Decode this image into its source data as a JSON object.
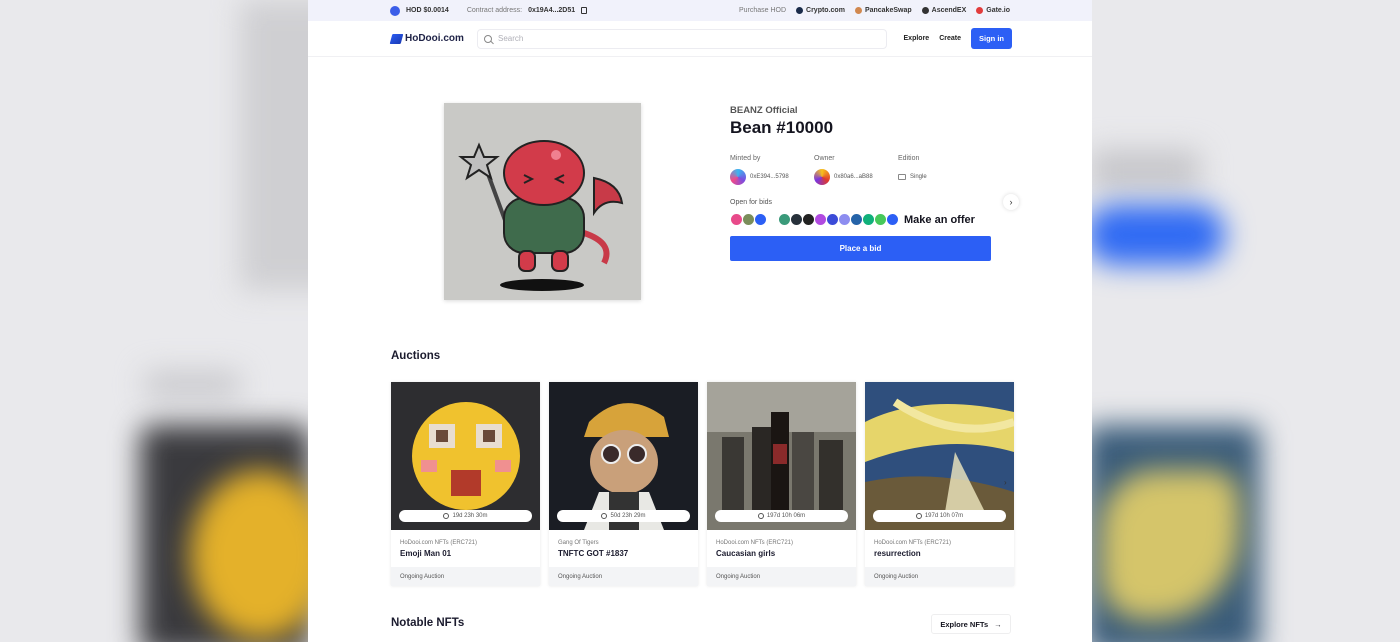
{
  "topbar": {
    "price": "HOD $0.0014",
    "contract_label": "Contract address:",
    "contract_value": "0x19A4...2D51",
    "purchase_label": "Purchase HOD",
    "exchanges": [
      {
        "name": "Crypto.com",
        "color": "#1a2b4a"
      },
      {
        "name": "PancakeSwap",
        "color": "#d1884f"
      },
      {
        "name": "AscendEX",
        "color": "#333333"
      },
      {
        "name": "Gate.io",
        "color": "#e23c3c"
      }
    ]
  },
  "nav": {
    "logo": "HoDooi.com",
    "search_placeholder": "Search",
    "explore": "Explore",
    "create": "Create",
    "signin": "Sign in"
  },
  "hero": {
    "collection": "BEANZ Official",
    "title": "Bean #10000",
    "minted_by_label": "Minted by",
    "owner_label": "Owner",
    "edition_label": "Edition",
    "minted_by_value": "0xE394...5798",
    "owner_value": "0x80a6...aB88",
    "edition_value": "Single",
    "open_for_bids": "Open for bids",
    "make_offer": "Make an offer",
    "place_bid": "Place a bid",
    "token_colors": [
      "#e84a8a",
      "#7a8d5a",
      "#2c5ff5",
      "#ffffff",
      "#3a9a7a",
      "#27303a",
      "#222222",
      "#b04ae0",
      "#3b4bd8",
      "#8d8df0",
      "#2563a8",
      "#10b07a",
      "#46c85a",
      "#2c5ff5"
    ]
  },
  "auctions": {
    "title": "Auctions",
    "cards": [
      {
        "timer": "19d 23h 30m",
        "collection": "HoDooi.com NFTs (ERC721)",
        "name": "Emoji Man 01",
        "status": "Ongoing Auction"
      },
      {
        "timer": "50d 23h 29m",
        "collection": "Gang Of Tigers",
        "name": "TNFTC GOT #1837",
        "status": "Ongoing Auction"
      },
      {
        "timer": "197d 10h 06m",
        "collection": "HoDooi.com NFTs (ERC721)",
        "name": "Caucasian girls",
        "status": "Ongoing Auction"
      },
      {
        "timer": "197d 10h 07m",
        "collection": "HoDooi.com NFTs (ERC721)",
        "name": "resurrection",
        "status": "Ongoing Auction"
      }
    ]
  },
  "notable": {
    "title": "Notable NFTs",
    "explore": "Explore NFTs"
  }
}
